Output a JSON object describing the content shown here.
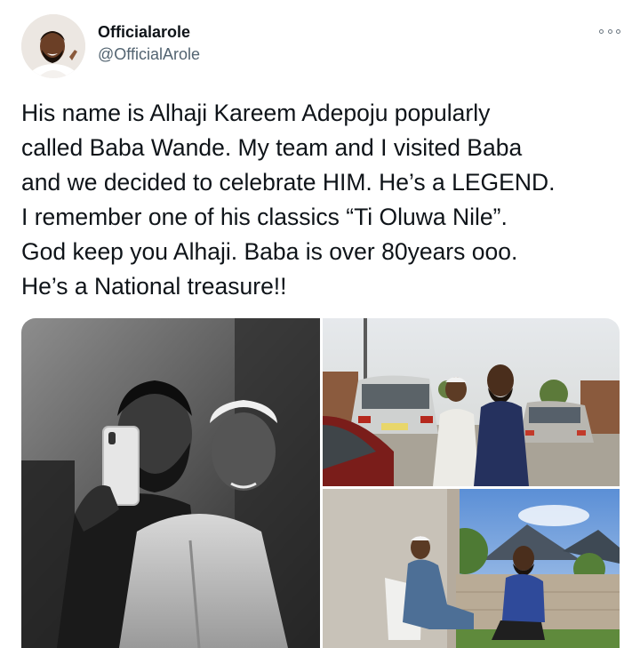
{
  "tweet": {
    "display_name": "Officialarole",
    "handle": "@OfficialArole",
    "more_icon": "more-horizontal-icon",
    "text": "His name is Alhaji Kareem Adepoju popularly\ncalled Baba Wande. My team and I visited Baba\nand we decided to celebrate HIM. He’s a LEGEND.\nI remember one of his classics “Ti Oluwa Nile”.\nGod keep you Alhaji. Baba is over 80years ooo.\nHe’s a National treasure!!"
  },
  "media": {
    "photos": [
      {
        "style": "black-and-white"
      },
      {
        "style": "color"
      },
      {
        "style": "color"
      }
    ]
  },
  "colors": {
    "text": "#0f1419",
    "secondary": "#536471",
    "background": "#ffffff"
  }
}
